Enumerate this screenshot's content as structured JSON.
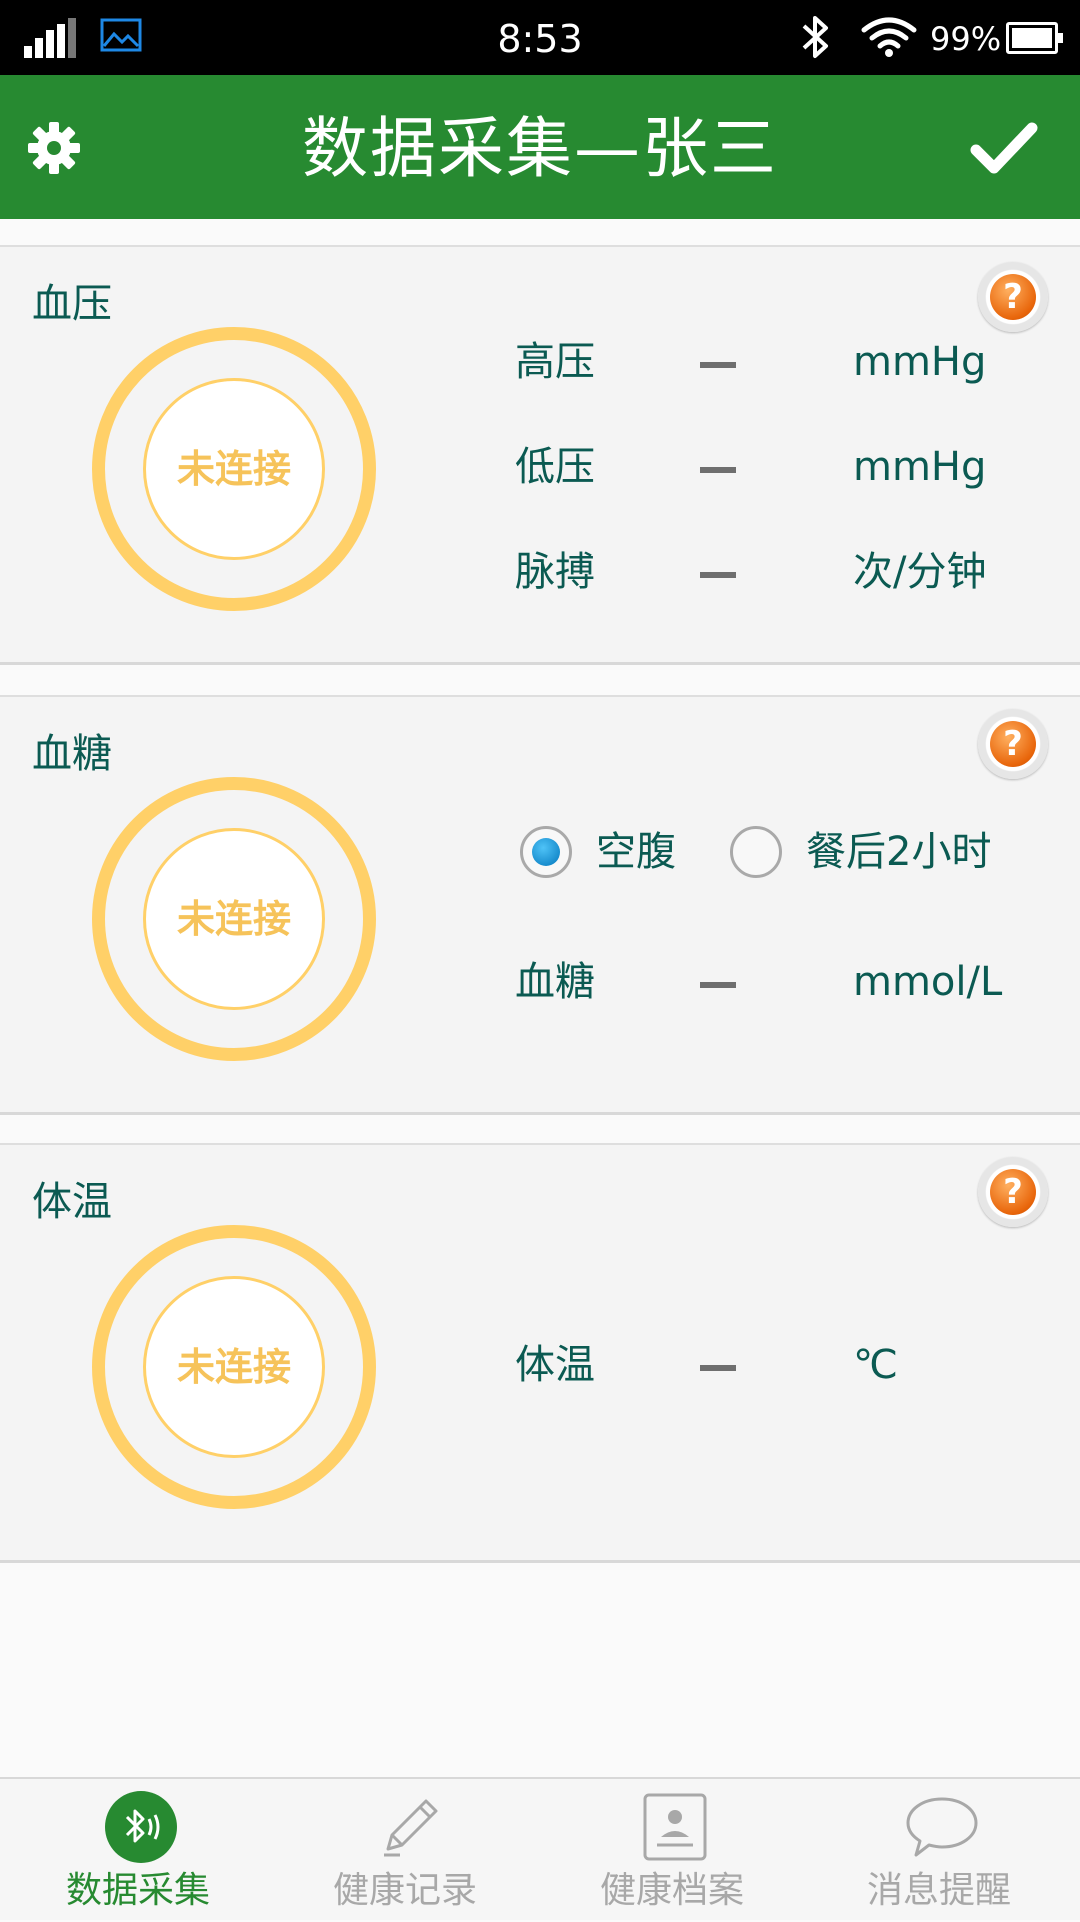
{
  "status_bar": {
    "time": "8:53",
    "battery": "99%"
  },
  "app_bar": {
    "title": "数据采集—张三"
  },
  "cards": {
    "blood_pressure": {
      "heading": "血压",
      "status": "未连接",
      "rows": [
        {
          "label": "高压",
          "value": "–",
          "unit": "mmHg"
        },
        {
          "label": "低压",
          "value": "–",
          "unit": "mmHg"
        },
        {
          "label": "脉搏",
          "value": "–",
          "unit": "次/分钟"
        }
      ]
    },
    "blood_sugar": {
      "heading": "血糖",
      "status": "未连接",
      "radio_options": [
        {
          "label": "空腹",
          "checked": true
        },
        {
          "label": "餐后2小时",
          "checked": false
        }
      ],
      "rows": [
        {
          "label": "血糖",
          "value": "–",
          "unit": "mmol/L"
        }
      ]
    },
    "temperature": {
      "heading": "体温",
      "status": "未连接",
      "rows": [
        {
          "label": "体温",
          "value": "–",
          "unit": "℃"
        }
      ]
    }
  },
  "bottom_nav": {
    "items": [
      {
        "label": "数据采集",
        "icon": "bluetooth-sensor-icon",
        "active": true
      },
      {
        "label": "健康记录",
        "icon": "pencil-icon",
        "active": false
      },
      {
        "label": "健康档案",
        "icon": "profile-card-icon",
        "active": false
      },
      {
        "label": "消息提醒",
        "icon": "chat-bubble-icon",
        "active": false
      }
    ]
  },
  "colors": {
    "primary": "#278a31",
    "text": "#0b5a52",
    "ring": "#ffd068",
    "help": "#e8650a",
    "inactive": "#a8a8a8"
  }
}
